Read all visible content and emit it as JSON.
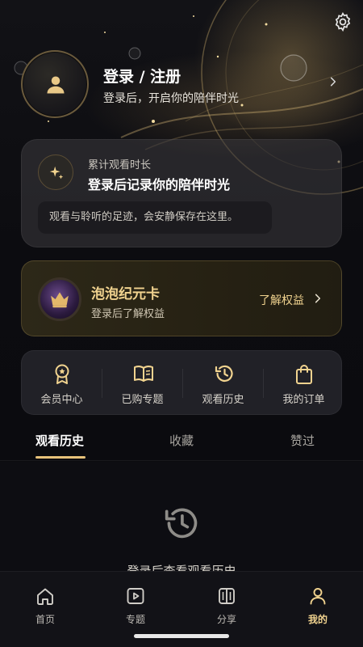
{
  "profile": {
    "title": "登录 / 注册",
    "subtitle": "登录后，开启你的陪伴时光"
  },
  "watch_card": {
    "label": "累计观看时长",
    "title": "登录后记录你的陪伴时光",
    "note": "观看与聆听的足迹，会安静保存在这里。"
  },
  "vip_card": {
    "title": "泡泡纪元卡",
    "subtitle": "登录后了解权益",
    "link": "了解权益"
  },
  "quick_actions": [
    {
      "label": "会员中心",
      "icon": "badge-icon"
    },
    {
      "label": "已购专题",
      "icon": "book-icon"
    },
    {
      "label": "观看历史",
      "icon": "history-icon"
    },
    {
      "label": "我的订单",
      "icon": "bag-icon"
    }
  ],
  "tabs": [
    {
      "label": "观看历史",
      "active": true
    },
    {
      "label": "收藏",
      "active": false
    },
    {
      "label": "赞过",
      "active": false
    }
  ],
  "empty_state": {
    "text": "登录后查看观看历史"
  },
  "bottom_nav": [
    {
      "label": "首页",
      "icon": "home-icon",
      "active": false
    },
    {
      "label": "专题",
      "icon": "play-icon",
      "active": false
    },
    {
      "label": "分享",
      "icon": "share-icon",
      "active": false
    },
    {
      "label": "我的",
      "icon": "person-icon",
      "active": true
    }
  ],
  "colors": {
    "accent_gold": "#f1d38f",
    "background": "#0b0b0f",
    "card": "#2e2d32"
  }
}
